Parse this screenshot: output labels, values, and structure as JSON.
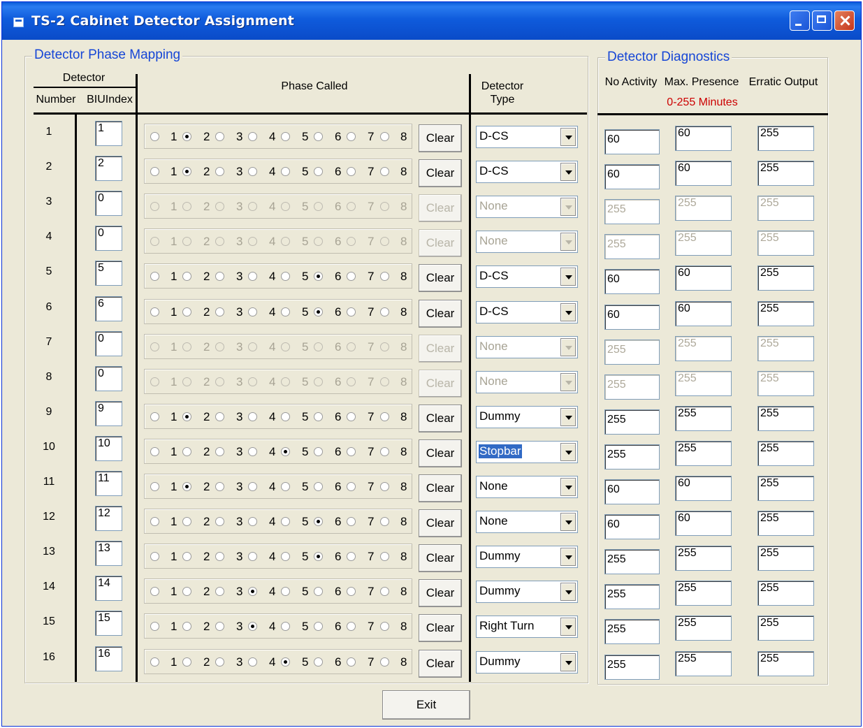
{
  "window": {
    "title": "TS-2 Cabinet Detector Assignment"
  },
  "mapping": {
    "legend": "Detector Phase Mapping",
    "h_detector": "Detector",
    "h_number": "Number",
    "h_biu": "BIUIndex",
    "h_phase": "Phase Called",
    "h_type_1": "Detector",
    "h_type_2": "Type"
  },
  "diag": {
    "legend": "Detector Diagnostics",
    "h_noact": "No Activity",
    "h_maxpres": "Max. Presence",
    "h_erratic": "Erratic Output",
    "range": "0-255  Minutes",
    "range_color": "#cc0000"
  },
  "phase_labels": [
    "1",
    "2",
    "3",
    "4",
    "5",
    "6",
    "7",
    "8"
  ],
  "clear_label": "Clear",
  "exit_label": "Exit",
  "rows": [
    {
      "num": "1",
      "biu": "1",
      "phase": 2,
      "enabled": true,
      "type": "D-CS",
      "noact": "60",
      "maxpres": "60",
      "erratic": "255"
    },
    {
      "num": "2",
      "biu": "2",
      "phase": 2,
      "enabled": true,
      "type": "D-CS",
      "noact": "60",
      "maxpres": "60",
      "erratic": "255"
    },
    {
      "num": "3",
      "biu": "0",
      "phase": 0,
      "enabled": false,
      "type": "None",
      "noact": "255",
      "maxpres": "255",
      "erratic": "255"
    },
    {
      "num": "4",
      "biu": "0",
      "phase": 0,
      "enabled": false,
      "type": "None",
      "noact": "255",
      "maxpres": "255",
      "erratic": "255"
    },
    {
      "num": "5",
      "biu": "5",
      "phase": 6,
      "enabled": true,
      "type": "D-CS",
      "noact": "60",
      "maxpres": "60",
      "erratic": "255"
    },
    {
      "num": "6",
      "biu": "6",
      "phase": 6,
      "enabled": true,
      "type": "D-CS",
      "noact": "60",
      "maxpres": "60",
      "erratic": "255"
    },
    {
      "num": "7",
      "biu": "0",
      "phase": 0,
      "enabled": false,
      "type": "None",
      "noact": "255",
      "maxpres": "255",
      "erratic": "255"
    },
    {
      "num": "8",
      "biu": "0",
      "phase": 0,
      "enabled": false,
      "type": "None",
      "noact": "255",
      "maxpres": "255",
      "erratic": "255"
    },
    {
      "num": "9",
      "biu": "9",
      "phase": 2,
      "enabled": true,
      "type": "Dummy",
      "noact": "255",
      "maxpres": "255",
      "erratic": "255"
    },
    {
      "num": "10",
      "biu": "10",
      "phase": 5,
      "enabled": true,
      "type": "Stopbar",
      "type_selected": true,
      "noact": "255",
      "maxpres": "255",
      "erratic": "255"
    },
    {
      "num": "11",
      "biu": "11",
      "phase": 2,
      "enabled": true,
      "type": "None",
      "noact": "60",
      "maxpres": "60",
      "erratic": "255"
    },
    {
      "num": "12",
      "biu": "12",
      "phase": 6,
      "enabled": true,
      "type": "None",
      "noact": "60",
      "maxpres": "60",
      "erratic": "255"
    },
    {
      "num": "13",
      "biu": "13",
      "phase": 6,
      "enabled": true,
      "type": "Dummy",
      "noact": "255",
      "maxpres": "255",
      "erratic": "255"
    },
    {
      "num": "14",
      "biu": "14",
      "phase": 4,
      "enabled": true,
      "type": "Dummy",
      "noact": "255",
      "maxpres": "255",
      "erratic": "255"
    },
    {
      "num": "15",
      "biu": "15",
      "phase": 4,
      "enabled": true,
      "type": "Right Turn",
      "noact": "255",
      "maxpres": "255",
      "erratic": "255"
    },
    {
      "num": "16",
      "biu": "16",
      "phase": 5,
      "enabled": true,
      "type": "Dummy",
      "noact": "255",
      "maxpres": "255",
      "erratic": "255"
    }
  ]
}
